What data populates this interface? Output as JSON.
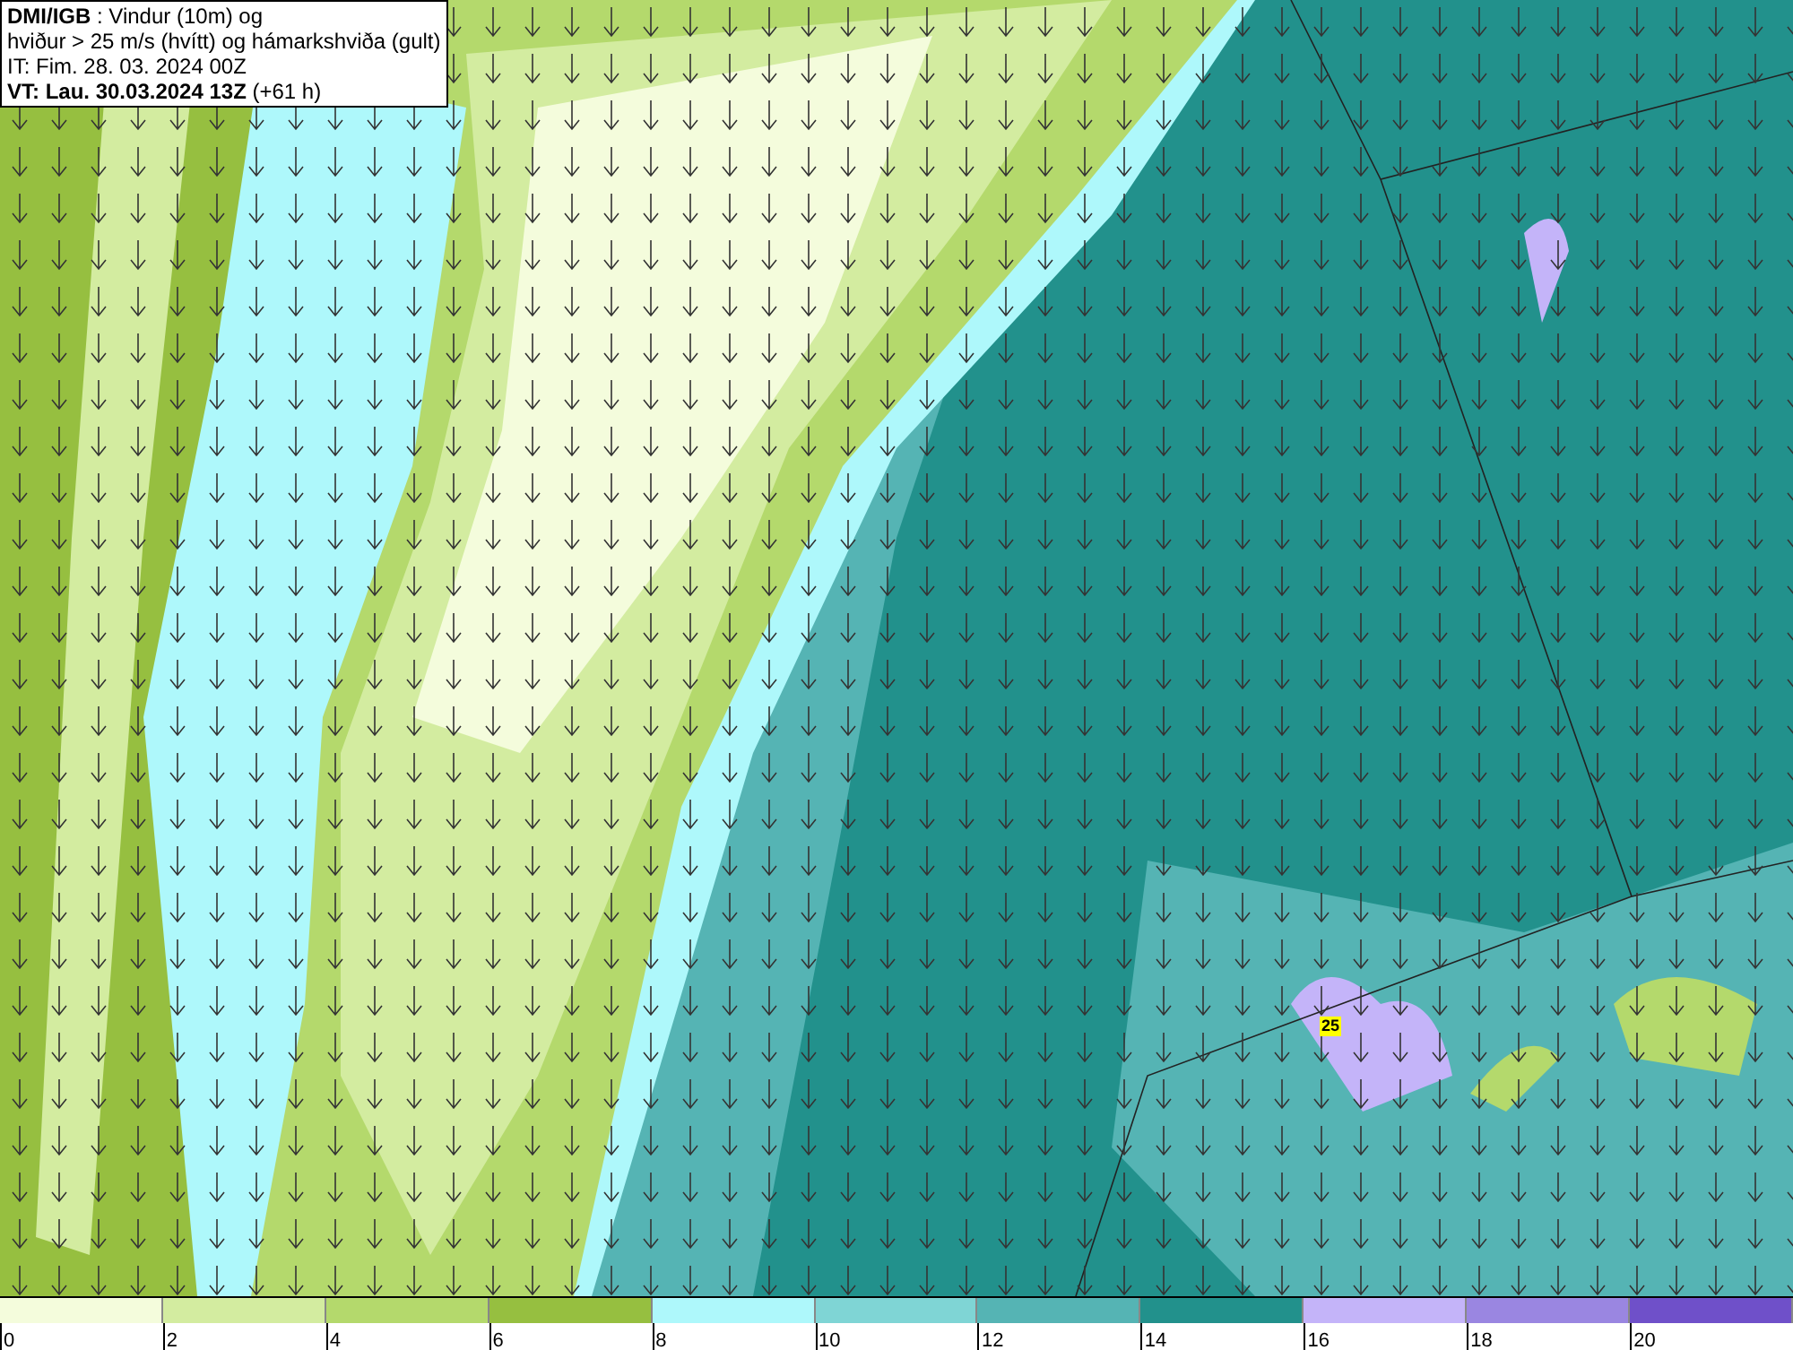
{
  "title_box": {
    "lines": [
      "**DMI/IGB** : Vindur (10m) og",
      "hviður > 25 m/s (hvítt) og hámarkshviða (gult)",
      "IT: Fim. 28. 03. 2024 00Z",
      "**VT: Lau. 30.03.2024 13Z** (+61 h)"
    ]
  },
  "map": {
    "gust_label": "25"
  },
  "legend": {
    "bins": [
      {
        "color": "#f4fcdc"
      },
      {
        "color": "#d3eca0"
      },
      {
        "color": "#b4d96c"
      },
      {
        "color": "#96bf40"
      },
      {
        "color": "#aef8fb"
      },
      {
        "color": "#7fd5d5"
      },
      {
        "color": "#55b4b4"
      },
      {
        "color": "#22918c"
      },
      {
        "color": "#c4b4f9"
      },
      {
        "color": "#9a86e1"
      },
      {
        "color": "#6f50c9"
      }
    ],
    "ticks": [
      "0",
      "2",
      "4",
      "6",
      "8",
      "10",
      "12",
      "14",
      "16",
      "18",
      "20"
    ]
  }
}
